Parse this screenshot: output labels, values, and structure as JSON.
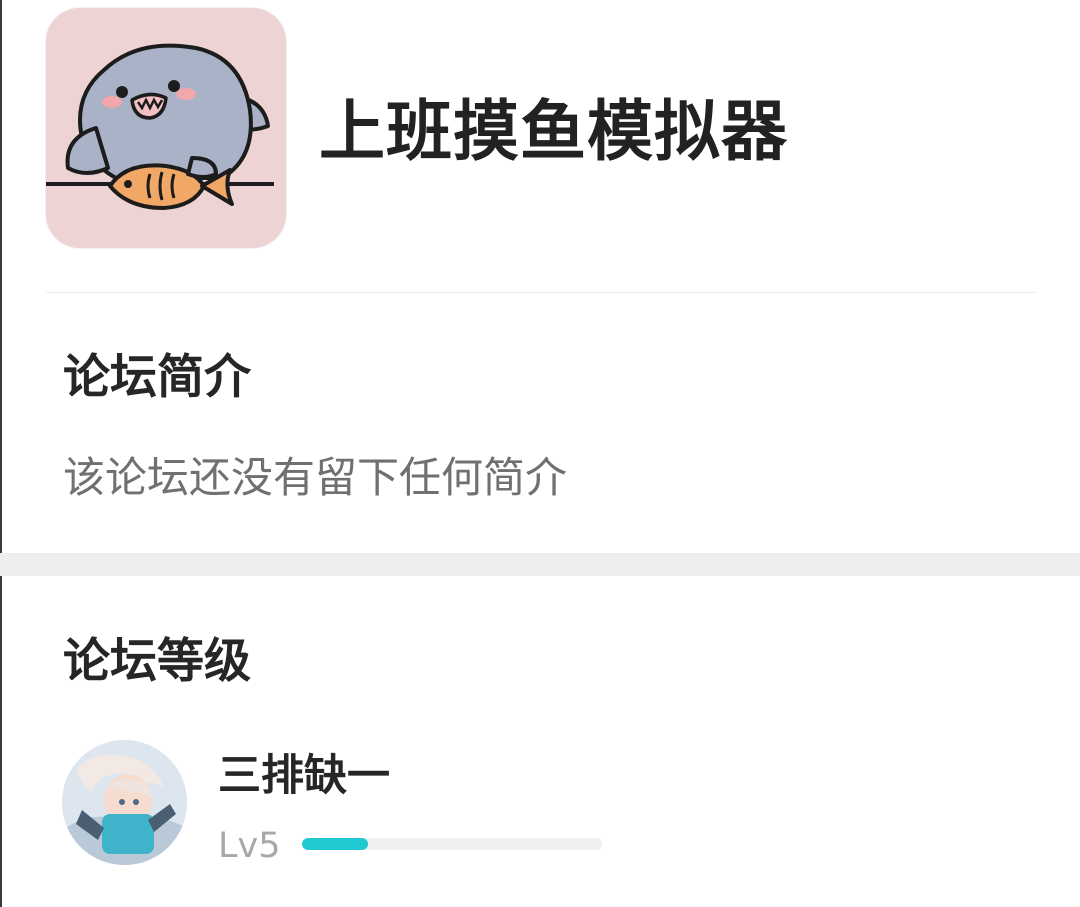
{
  "forum": {
    "title": "上班摸鱼模拟器",
    "icon": "shark-holding-fish-icon"
  },
  "intro": {
    "heading": "论坛简介",
    "text": "该论坛还没有留下任何简介"
  },
  "level": {
    "heading": "论坛等级",
    "member": {
      "name": "三排缺一",
      "level_label": "Lv5",
      "progress_fraction": 0.22,
      "progress_color": "#1ec9cf"
    }
  }
}
